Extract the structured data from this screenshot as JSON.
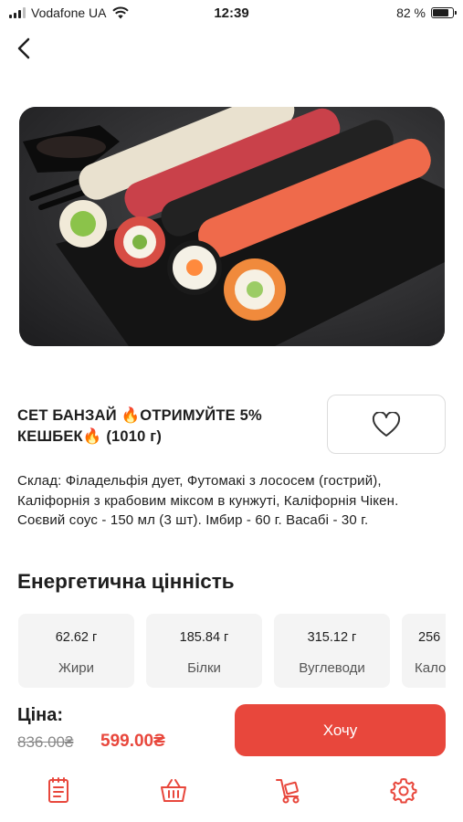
{
  "status_bar": {
    "carrier": "Vodafone UA",
    "time": "12:39",
    "battery": "82 %",
    "battery_level": 0.82
  },
  "product": {
    "title": "СЕТ БАНЗАЙ 🔥ОТРИМУЙТЕ 5% КЕШБЕК🔥 (1010 г)",
    "composition": "Склад: Філадельфія дует, Футомакі з лососем (гострий), Каліфорнія з крабовим міксом в кунжуті, Каліфорнія Чікен. Соєвий соус - 150 мл (3 шт). Імбир - 60 г. Васабі - 30 г.",
    "image_icon": "sushi-set-photo"
  },
  "energy": {
    "title": "Енергетична цінність",
    "items": [
      {
        "value": "62.62 г",
        "label": "Жири"
      },
      {
        "value": "185.84 г",
        "label": "Білки"
      },
      {
        "value": "315.12 г",
        "label": "Вуглеводи"
      },
      {
        "value": "256",
        "label": "Кало"
      }
    ]
  },
  "price": {
    "label": "Ціна:",
    "old": "836.00₴",
    "new": "599.00₴"
  },
  "actions": {
    "want_label": "Хочу"
  },
  "tab_bar": {
    "items": [
      "menu-icon",
      "basket-icon",
      "delivery-icon",
      "gear-icon"
    ]
  },
  "colors": {
    "accent": "#e8473c",
    "card_bg": "#f4f4f4",
    "text": "#1e1e1e"
  }
}
